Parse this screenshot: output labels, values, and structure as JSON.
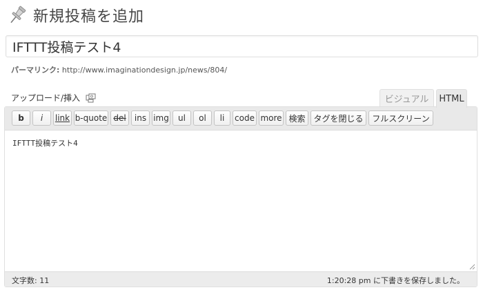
{
  "header": {
    "title": "新規投稿を追加",
    "icon": "pushpin-icon"
  },
  "post": {
    "title_value": "IFTTT投稿テスト4"
  },
  "permalink": {
    "label": "パーマリンク:",
    "url": "http://www.imaginationdesign.jp/news/804/"
  },
  "upload": {
    "label": "アップロード/挿入",
    "icon": "media-icon"
  },
  "tabs": {
    "visual": "ビジュアル",
    "html": "HTML",
    "active": "HTML"
  },
  "toolbar": {
    "buttons": [
      "b",
      "i",
      "link",
      "b-quote",
      "del",
      "ins",
      "img",
      "ul",
      "ol",
      "li",
      "code",
      "more",
      "検索",
      "タグを閉じる",
      "フルスクリーン"
    ]
  },
  "editor": {
    "content": "IFTTT投稿テスト4"
  },
  "status": {
    "word_count": "文字数: 11",
    "autosave": "1:20:28 pm に下書きを保存しました。"
  }
}
